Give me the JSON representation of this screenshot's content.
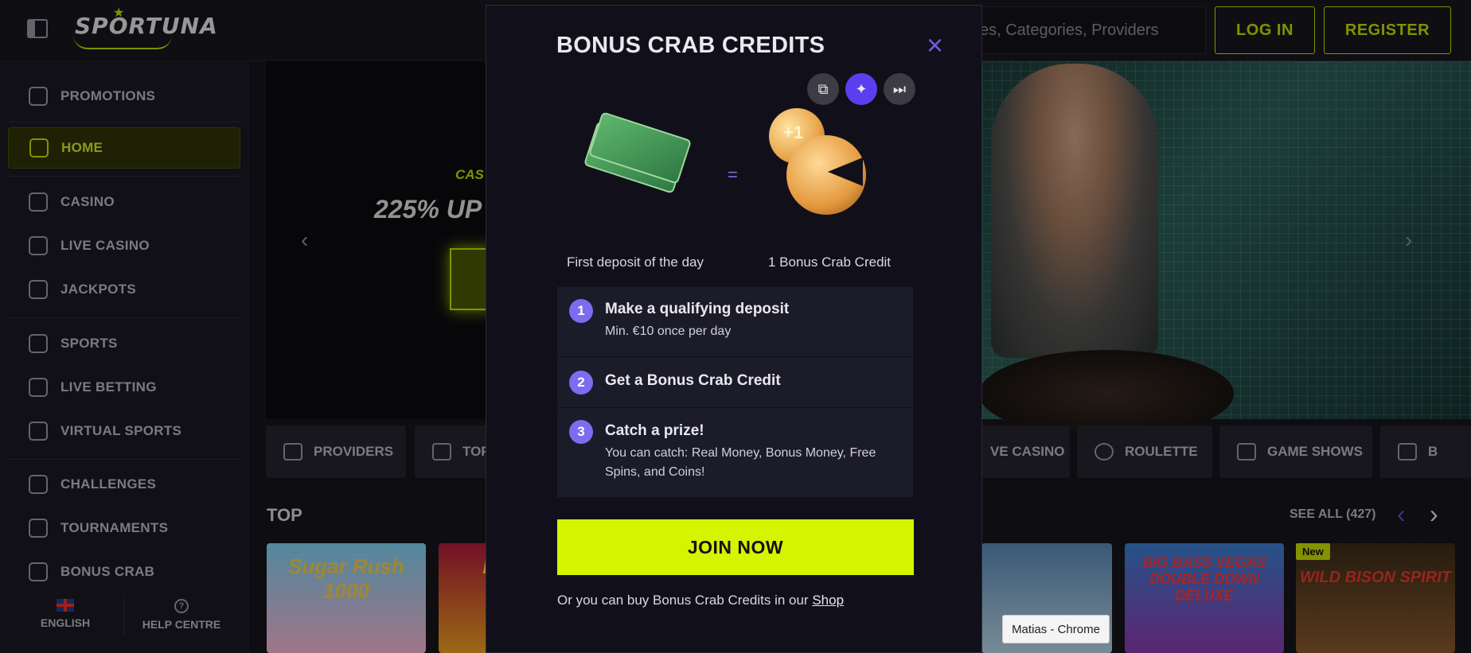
{
  "header": {
    "logo_text": "SPORTUNA",
    "search_placeholder": "es, Categories, Providers",
    "login_label": "LOG IN",
    "register_label": "REGISTER"
  },
  "sidebar": {
    "items": [
      {
        "label": "PROMOTIONS",
        "icon": "gift-icon"
      },
      {
        "label": "HOME",
        "icon": "home-icon",
        "active": true
      },
      {
        "label": "CASINO",
        "icon": "cards-icon"
      },
      {
        "label": "LIVE CASINO",
        "icon": "live-card-icon"
      },
      {
        "label": "JACKPOTS",
        "icon": "jackpot-icon"
      },
      {
        "label": "SPORTS",
        "icon": "soccer-ball-icon"
      },
      {
        "label": "LIVE BETTING",
        "icon": "video-icon"
      },
      {
        "label": "VIRTUAL SPORTS",
        "icon": "gamepad-icon"
      },
      {
        "label": "CHALLENGES",
        "icon": "medal-icon"
      },
      {
        "label": "TOURNAMENTS",
        "icon": "podium-icon"
      },
      {
        "label": "BONUS CRAB",
        "icon": "crab-icon"
      }
    ],
    "language_label": "ENGLISH",
    "help_label": "HELP CENTRE"
  },
  "hero": {
    "kicker": "CAS",
    "headline": "225% UP"
  },
  "categories": [
    {
      "label": "PROVIDERS",
      "icon": "layers-icon"
    },
    {
      "label": "TOP",
      "icon": "crown-icon"
    },
    {
      "label": "VE CASINO",
      "icon": "live-icon"
    },
    {
      "label": "ROULETTE",
      "icon": "roulette-icon"
    },
    {
      "label": "GAME SHOWS",
      "icon": "microphone-icon"
    },
    {
      "label": "B",
      "icon": "slot-icon"
    }
  ],
  "top_section": {
    "title": "TOP",
    "see_all": "SEE ALL (427)",
    "new_badge": "New",
    "games": [
      "Sugar Rush 1000",
      "BR PIG",
      "BIG BASS VEGAS DOUBLE DOWN DELUXE",
      "WILD BISON SPIRIT"
    ]
  },
  "modal": {
    "title": "BONUS CRAB CREDITS",
    "close_icon": "×",
    "first_caption": "First deposit of the day",
    "equals": "=",
    "coin_label": "+1",
    "second_caption": "1 Bonus Crab Credit",
    "steps": [
      {
        "num": "1",
        "title": "Make a qualifying deposit",
        "desc": "Min. €10 once per day"
      },
      {
        "num": "2",
        "title": "Get a Bonus Crab Credit",
        "desc": ""
      },
      {
        "num": "3",
        "title": "Catch a prize!",
        "desc": "You can catch: Real Money, Bonus Money, Free Spins, and Coins!"
      }
    ],
    "join_label": "JOIN NOW",
    "shop_text": "Or you can buy Bonus Crab Credits in our",
    "shop_link": "Shop"
  },
  "tooltip": "Matias - Chrome",
  "colors": {
    "accent": "#d4f400",
    "purple": "#7c6cf0",
    "background": "#16151d"
  }
}
